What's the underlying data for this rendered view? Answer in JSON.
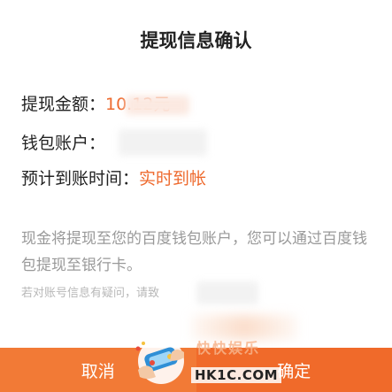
{
  "dialog": {
    "title": "提现信息确认",
    "rows": [
      {
        "label": "提现金额：",
        "value": "10.12元"
      },
      {
        "label": "钱包账户：",
        "value": ""
      },
      {
        "label": "预计到账时间：",
        "value": "实时到帐"
      }
    ],
    "description": "现金将提现至您的百度钱包账户，您可以通过百度钱包提现至银行卡。",
    "note": "若对账号信息有疑问，请致"
  },
  "buttons": {
    "cancel": "取消",
    "confirm": "确定"
  },
  "watermark": {
    "text_cn": "快快娱乐",
    "text_en": "HK1C.COM"
  },
  "colors": {
    "accent": "#ee6a2e",
    "button_bar": "#f4782f",
    "title_text": "#222222",
    "muted_text": "#999999"
  }
}
